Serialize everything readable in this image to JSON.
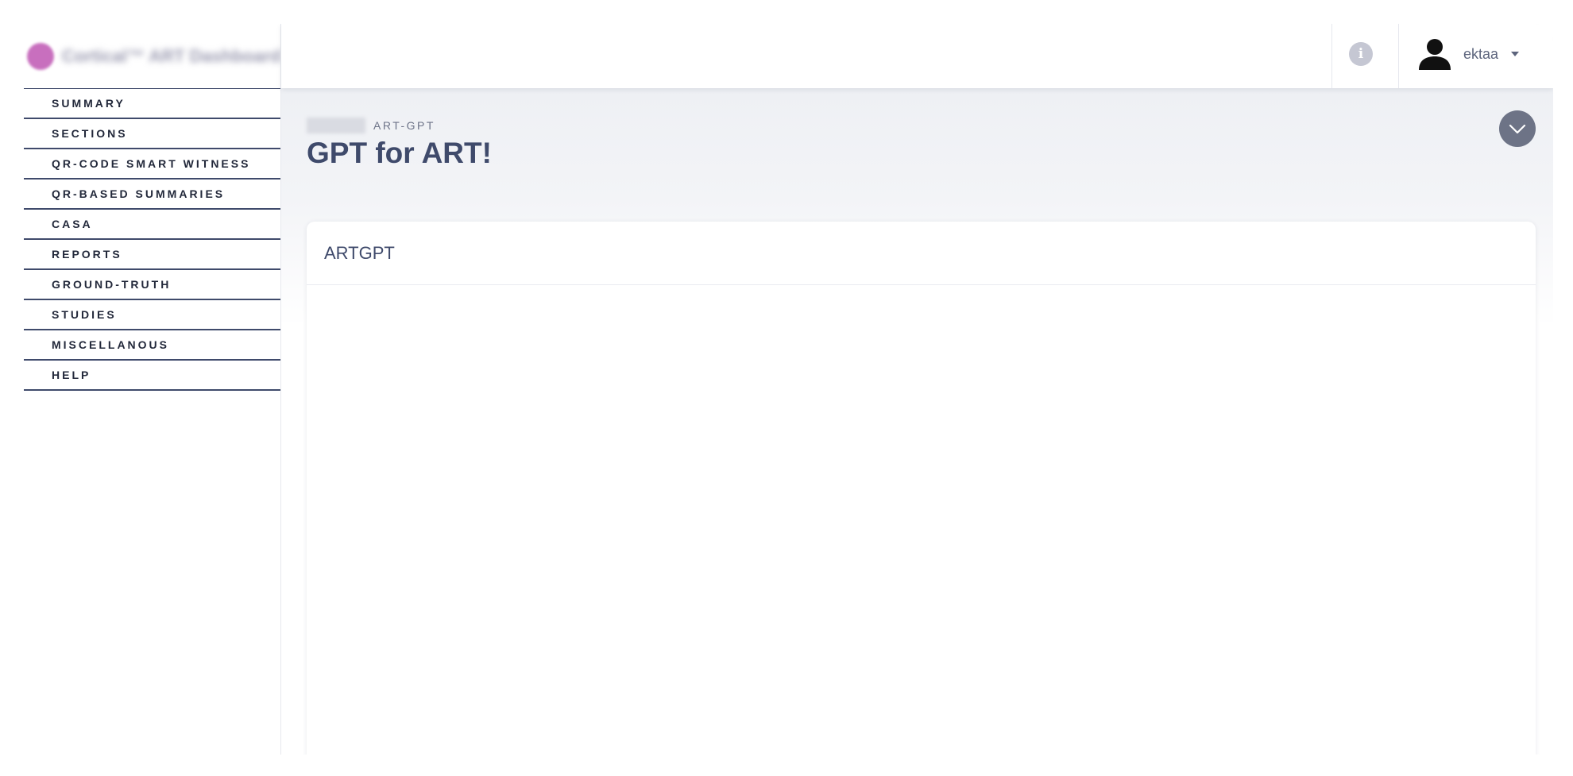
{
  "brand": {
    "logo_color": "#c86fbe",
    "name": "Cortical™ ART Dashboard"
  },
  "sidebar": {
    "items": [
      {
        "label": "SUMMARY"
      },
      {
        "label": "SECTIONS"
      },
      {
        "label": "QR-CODE SMART WITNESS"
      },
      {
        "label": "QR-BASED SUMMARIES"
      },
      {
        "label": "CASA"
      },
      {
        "label": "REPORTS"
      },
      {
        "label": "GROUND-TRUTH"
      },
      {
        "label": "STUDIES"
      },
      {
        "label": "MISCELLANOUS"
      },
      {
        "label": "HELP"
      }
    ]
  },
  "header": {
    "info_icon": "info-icon",
    "info_glyph": "i",
    "user_icon": "user-icon",
    "user_name": "ektaa"
  },
  "main": {
    "breadcrumb": "ART-GPT",
    "title": "GPT for ART!",
    "collapse_icon": "chevron-down-icon",
    "card": {
      "title": "ARTGPT"
    }
  },
  "colors": {
    "accent": "#3f4a6b",
    "button_gray": "#6d7386",
    "info_gray": "#c5c7d3"
  }
}
